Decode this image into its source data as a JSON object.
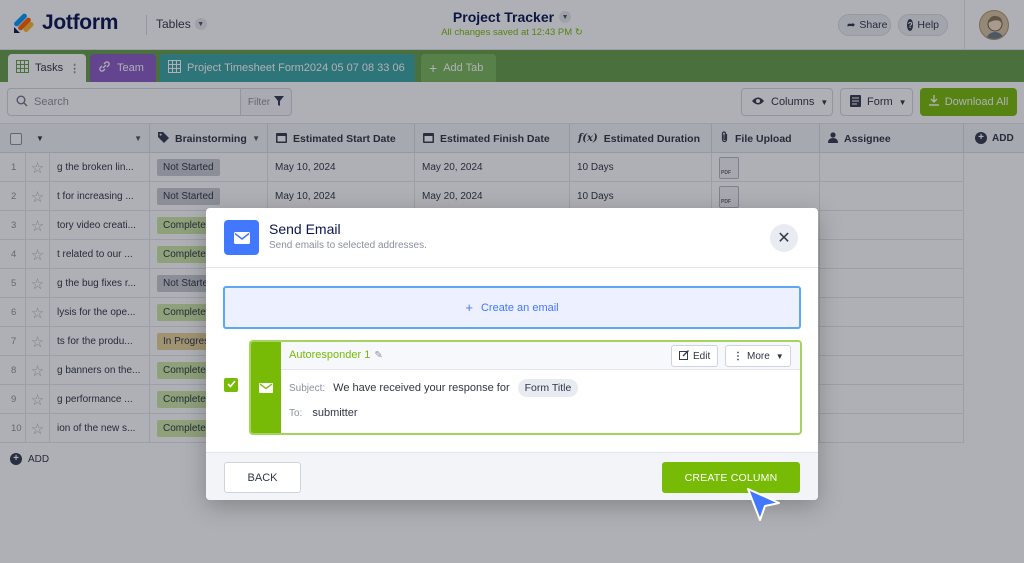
{
  "app": {
    "brand": "Jotform",
    "section": "Tables",
    "title": "Project Tracker",
    "save_status": "All changes saved at 12:43 PM",
    "share_label": "Share",
    "help_label": "Help"
  },
  "tabs": [
    {
      "label": "Tasks"
    },
    {
      "label": "Team"
    },
    {
      "label": "Project Timesheet Form2024 05 07 08 33 06"
    },
    {
      "label": "Add Tab"
    }
  ],
  "toolbar": {
    "search_placeholder": "Search",
    "filter_label": "Filter",
    "columns_label": "Columns",
    "form_label": "Form",
    "download_label": "Download All"
  },
  "table": {
    "columns": [
      "Brainstorming",
      "Estimated Start Date",
      "Estimated Finish Date",
      "Estimated Duration",
      "File Upload",
      "Assignee"
    ],
    "add_column_label": "ADD",
    "add_row_label": "ADD",
    "rows": [
      {
        "num": "1",
        "task": "g the broken lin...",
        "status": "Not Started",
        "start": "May 10, 2024",
        "finish": "May 20, 2024",
        "duration": "10 Days",
        "file": true
      },
      {
        "num": "2",
        "task": "t for increasing ...",
        "status": "Not Started",
        "start": "May 10, 2024",
        "finish": "May 20, 2024",
        "duration": "10 Days",
        "file": true
      },
      {
        "num": "3",
        "task": "tory video creati...",
        "status": "Complete",
        "start": "",
        "finish": "",
        "duration": "",
        "file": false
      },
      {
        "num": "4",
        "task": "t related to our ...",
        "status": "Complete",
        "start": "",
        "finish": "",
        "duration": "",
        "file": false
      },
      {
        "num": "5",
        "task": "g the bug fixes r...",
        "status": "Not Started",
        "start": "",
        "finish": "",
        "duration": "",
        "file": false
      },
      {
        "num": "6",
        "task": "lysis for the ope...",
        "status": "Complete",
        "start": "",
        "finish": "",
        "duration": "",
        "file": false
      },
      {
        "num": "7",
        "task": "ts for the produ...",
        "status": "In Progress",
        "start": "",
        "finish": "",
        "duration": "",
        "file": false
      },
      {
        "num": "8",
        "task": "g banners on the...",
        "status": "Complete",
        "start": "",
        "finish": "",
        "duration": "",
        "file": false
      },
      {
        "num": "9",
        "task": "g performance ...",
        "status": "Complete",
        "start": "",
        "finish": "",
        "duration": "",
        "file": false
      },
      {
        "num": "10",
        "task": "ion of the new s...",
        "status": "Complete",
        "start": "",
        "finish": "",
        "duration": "",
        "file": false
      }
    ]
  },
  "modal": {
    "title": "Send Email",
    "subtitle": "Send emails to selected addresses.",
    "create_email_label": "Create an email",
    "email": {
      "name": "Autoresponder 1",
      "edit_label": "Edit",
      "more_label": "More",
      "subject_label": "Subject:",
      "subject_text": "We have received your response for",
      "subject_tag": "Form Title",
      "to_label": "To:",
      "to_value": "submitter",
      "selected": true
    },
    "back_label": "BACK",
    "create_column_label": "CREATE COLUMN"
  },
  "colors": {
    "brand_green": "#78bb07",
    "tabs_green": "#67a04a",
    "accent_blue": "#4277ff",
    "not_started": "#c9cbd1",
    "complete": "#cde9a6",
    "in_progress": "#e9d49a"
  },
  "icons": [
    "jotform-logo-icon",
    "chevron-down-icon",
    "sync-icon",
    "share-icon",
    "help-icon",
    "table-icon",
    "link-icon",
    "search-icon",
    "filter-icon",
    "eye-icon",
    "form-icon",
    "download-icon",
    "star-icon",
    "calendar-icon",
    "function-icon",
    "paperclip-icon",
    "user-icon",
    "mail-icon",
    "close-icon",
    "pencil-icon",
    "edit-icon",
    "more-icon",
    "check-icon",
    "cursor-icon"
  ]
}
